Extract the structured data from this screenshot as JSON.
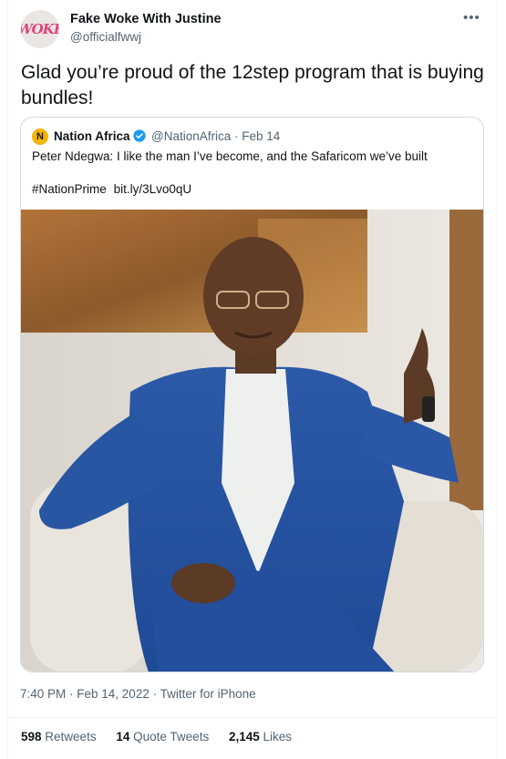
{
  "tweet": {
    "author_name": "Fake Woke With Justine",
    "author_handle": "@officialfwwj",
    "avatar_text": "WOKE",
    "text": "Glad you’re proud of the 12step program that is buying bundles!",
    "more_icon": "more-horizontal-icon"
  },
  "quote": {
    "avatar_letter": "N",
    "author_name": "Nation Africa",
    "author_handle": "@NationAfrica · Feb 14",
    "text": "Peter Ndegwa: I like the man I’ve become, and the Safaricom we’ve built",
    "hashtag": "#NationPrime",
    "link": "bit.ly/3Lvo0qU",
    "verified_icon": "verified-badge-icon",
    "verified_color": "#1d9bf0"
  },
  "meta": {
    "timestamp": "7:40 PM · Feb 14, 2022 · Twitter for iPhone"
  },
  "stats": {
    "retweets_count": "598",
    "retweets_label": "Retweets",
    "quotes_count": "14",
    "quotes_label": "Quote Tweets",
    "likes_count": "2,145",
    "likes_label": "Likes"
  },
  "colors": {
    "text_primary": "#0f1419",
    "text_secondary": "#536471",
    "border": "#cfd9de"
  }
}
